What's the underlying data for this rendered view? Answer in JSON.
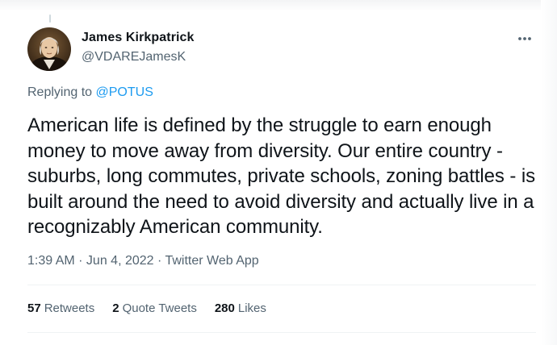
{
  "author": {
    "name": "James Kirkpatrick",
    "handle": "@VDAREJamesK"
  },
  "reply": {
    "prefix": "Replying to ",
    "mention": "@POTUS"
  },
  "tweet": {
    "text": "American life is defined by the struggle to earn enough money to move away from diversity. Our entire country - suburbs, long commutes, private schools, zoning battles - is built around the need to avoid diversity and actually live in a recognizably American community."
  },
  "meta": {
    "time": "1:39 AM",
    "sep1": " · ",
    "date": "Jun 4, 2022",
    "sep2": " · ",
    "source": "Twitter Web App"
  },
  "stats": {
    "retweets_count": "57",
    "retweets_label": "Retweets",
    "quotes_count": "2",
    "quotes_label": "Quote Tweets",
    "likes_count": "280",
    "likes_label": "Likes"
  },
  "icons": {
    "more": "more-options-icon"
  },
  "colors": {
    "text": "#0f1419",
    "secondary": "#536471",
    "accent": "#1d9bf0",
    "divider": "#eff3f4"
  }
}
